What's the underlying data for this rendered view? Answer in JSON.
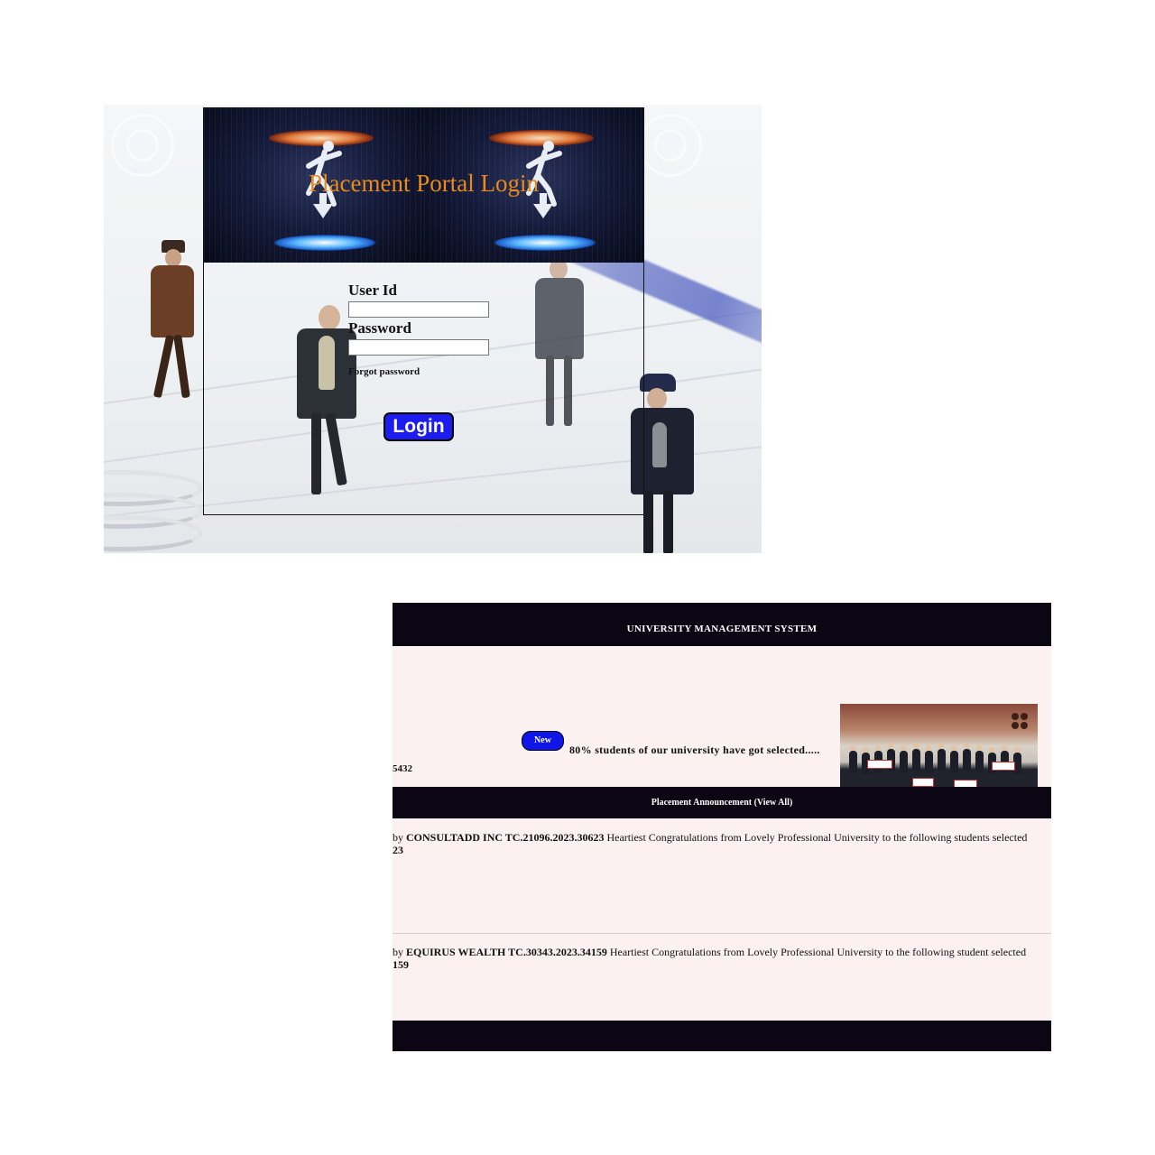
{
  "login": {
    "banner_title": "Placement Portal Login",
    "user_id_label": "User Id",
    "password_label": "Password",
    "user_id_value": "",
    "password_value": "",
    "forgot_password": "Forgot password",
    "login_button": "Login"
  },
  "dashboard": {
    "header_title": "UNIVERSITY MANAGEMENT SYSTEM",
    "ticker_id": "5432",
    "new_badge": "New",
    "news_text": "80% students of our university have got selected.....",
    "announcements_header": "Placement Announcement (View All)",
    "announcements": [
      {
        "prefix": "by ",
        "company": "CONSULTADD INC TC.21096.2023.30623",
        "text": " Heartiest Congratulations from Lovely Professional University to the following students selected",
        "continuation": "23"
      },
      {
        "prefix": "by ",
        "company": "EQUIRUS WEALTH TC.30343.2023.34159",
        "text": " Heartiest Congratulations from Lovely Professional University to the following student selected",
        "continuation": "159"
      }
    ]
  },
  "colors": {
    "banner_title": "#e88a1c",
    "login_button_bg": "#1c1cf0",
    "dash_bar": "#0c0513",
    "dash_bg": "#fcf1f1",
    "new_badge_bg": "#1015e8"
  }
}
